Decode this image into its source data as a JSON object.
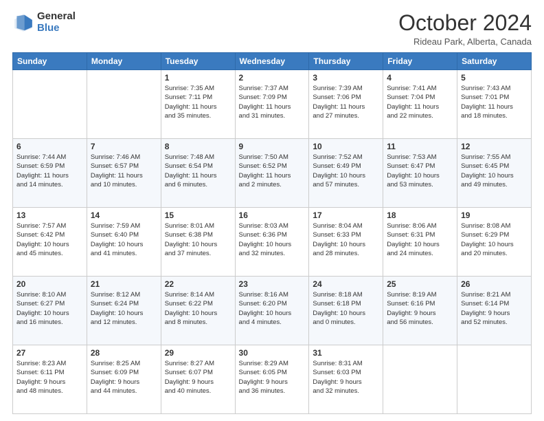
{
  "header": {
    "logo_general": "General",
    "logo_blue": "Blue",
    "month_title": "October 2024",
    "location": "Rideau Park, Alberta, Canada"
  },
  "days_of_week": [
    "Sunday",
    "Monday",
    "Tuesday",
    "Wednesday",
    "Thursday",
    "Friday",
    "Saturday"
  ],
  "weeks": [
    [
      {
        "day": "",
        "info": ""
      },
      {
        "day": "",
        "info": ""
      },
      {
        "day": "1",
        "info": "Sunrise: 7:35 AM\nSunset: 7:11 PM\nDaylight: 11 hours\nand 35 minutes."
      },
      {
        "day": "2",
        "info": "Sunrise: 7:37 AM\nSunset: 7:09 PM\nDaylight: 11 hours\nand 31 minutes."
      },
      {
        "day": "3",
        "info": "Sunrise: 7:39 AM\nSunset: 7:06 PM\nDaylight: 11 hours\nand 27 minutes."
      },
      {
        "day": "4",
        "info": "Sunrise: 7:41 AM\nSunset: 7:04 PM\nDaylight: 11 hours\nand 22 minutes."
      },
      {
        "day": "5",
        "info": "Sunrise: 7:43 AM\nSunset: 7:01 PM\nDaylight: 11 hours\nand 18 minutes."
      }
    ],
    [
      {
        "day": "6",
        "info": "Sunrise: 7:44 AM\nSunset: 6:59 PM\nDaylight: 11 hours\nand 14 minutes."
      },
      {
        "day": "7",
        "info": "Sunrise: 7:46 AM\nSunset: 6:57 PM\nDaylight: 11 hours\nand 10 minutes."
      },
      {
        "day": "8",
        "info": "Sunrise: 7:48 AM\nSunset: 6:54 PM\nDaylight: 11 hours\nand 6 minutes."
      },
      {
        "day": "9",
        "info": "Sunrise: 7:50 AM\nSunset: 6:52 PM\nDaylight: 11 hours\nand 2 minutes."
      },
      {
        "day": "10",
        "info": "Sunrise: 7:52 AM\nSunset: 6:49 PM\nDaylight: 10 hours\nand 57 minutes."
      },
      {
        "day": "11",
        "info": "Sunrise: 7:53 AM\nSunset: 6:47 PM\nDaylight: 10 hours\nand 53 minutes."
      },
      {
        "day": "12",
        "info": "Sunrise: 7:55 AM\nSunset: 6:45 PM\nDaylight: 10 hours\nand 49 minutes."
      }
    ],
    [
      {
        "day": "13",
        "info": "Sunrise: 7:57 AM\nSunset: 6:42 PM\nDaylight: 10 hours\nand 45 minutes."
      },
      {
        "day": "14",
        "info": "Sunrise: 7:59 AM\nSunset: 6:40 PM\nDaylight: 10 hours\nand 41 minutes."
      },
      {
        "day": "15",
        "info": "Sunrise: 8:01 AM\nSunset: 6:38 PM\nDaylight: 10 hours\nand 37 minutes."
      },
      {
        "day": "16",
        "info": "Sunrise: 8:03 AM\nSunset: 6:36 PM\nDaylight: 10 hours\nand 32 minutes."
      },
      {
        "day": "17",
        "info": "Sunrise: 8:04 AM\nSunset: 6:33 PM\nDaylight: 10 hours\nand 28 minutes."
      },
      {
        "day": "18",
        "info": "Sunrise: 8:06 AM\nSunset: 6:31 PM\nDaylight: 10 hours\nand 24 minutes."
      },
      {
        "day": "19",
        "info": "Sunrise: 8:08 AM\nSunset: 6:29 PM\nDaylight: 10 hours\nand 20 minutes."
      }
    ],
    [
      {
        "day": "20",
        "info": "Sunrise: 8:10 AM\nSunset: 6:27 PM\nDaylight: 10 hours\nand 16 minutes."
      },
      {
        "day": "21",
        "info": "Sunrise: 8:12 AM\nSunset: 6:24 PM\nDaylight: 10 hours\nand 12 minutes."
      },
      {
        "day": "22",
        "info": "Sunrise: 8:14 AM\nSunset: 6:22 PM\nDaylight: 10 hours\nand 8 minutes."
      },
      {
        "day": "23",
        "info": "Sunrise: 8:16 AM\nSunset: 6:20 PM\nDaylight: 10 hours\nand 4 minutes."
      },
      {
        "day": "24",
        "info": "Sunrise: 8:18 AM\nSunset: 6:18 PM\nDaylight: 10 hours\nand 0 minutes."
      },
      {
        "day": "25",
        "info": "Sunrise: 8:19 AM\nSunset: 6:16 PM\nDaylight: 9 hours\nand 56 minutes."
      },
      {
        "day": "26",
        "info": "Sunrise: 8:21 AM\nSunset: 6:14 PM\nDaylight: 9 hours\nand 52 minutes."
      }
    ],
    [
      {
        "day": "27",
        "info": "Sunrise: 8:23 AM\nSunset: 6:11 PM\nDaylight: 9 hours\nand 48 minutes."
      },
      {
        "day": "28",
        "info": "Sunrise: 8:25 AM\nSunset: 6:09 PM\nDaylight: 9 hours\nand 44 minutes."
      },
      {
        "day": "29",
        "info": "Sunrise: 8:27 AM\nSunset: 6:07 PM\nDaylight: 9 hours\nand 40 minutes."
      },
      {
        "day": "30",
        "info": "Sunrise: 8:29 AM\nSunset: 6:05 PM\nDaylight: 9 hours\nand 36 minutes."
      },
      {
        "day": "31",
        "info": "Sunrise: 8:31 AM\nSunset: 6:03 PM\nDaylight: 9 hours\nand 32 minutes."
      },
      {
        "day": "",
        "info": ""
      },
      {
        "day": "",
        "info": ""
      }
    ]
  ]
}
